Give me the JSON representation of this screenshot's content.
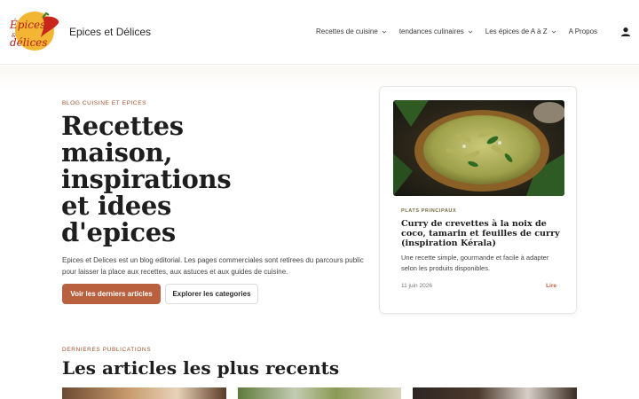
{
  "header": {
    "logo_text_line1": "Epices",
    "logo_text_line2": "delices",
    "site_title": "Epices et Délices",
    "nav": [
      {
        "label": "Recettes de cuisine",
        "has_dropdown": true
      },
      {
        "label": "tendances culinaires",
        "has_dropdown": true
      },
      {
        "label": "Les épices de A à Z",
        "has_dropdown": true
      },
      {
        "label": "A Propos",
        "has_dropdown": false
      }
    ],
    "user_icon": "user-icon"
  },
  "hero": {
    "eyebrow": "Blog cuisine et epices",
    "title": "Recettes maison, inspirations et idees d'epices",
    "description": "Epices et Delices est un blog editorial. Les pages commerciales sont retirees du parcours public pour laisser la place aux recettes, aux astuces et aux guides de cuisine.",
    "primary_button": "Voir les derniers articles",
    "secondary_button": "Explorer les categories"
  },
  "featured": {
    "category": "PLATS PRINCIPAUX",
    "title": "Curry de crevettes à la noix de coco, tamarin et feuilles de curry (inspiration Kérala)",
    "description": "Une recette simple, gourmande et facile à adapter selon les produits disponibles.",
    "date": "11 juin 2026",
    "read_link": "Lire"
  },
  "latest": {
    "eyebrow": "Dernieres publications",
    "title": "Les articles les plus recents"
  },
  "colors": {
    "accent": "#b9603e",
    "logo_circle": "#f2b534",
    "chili": "#c8261b"
  }
}
